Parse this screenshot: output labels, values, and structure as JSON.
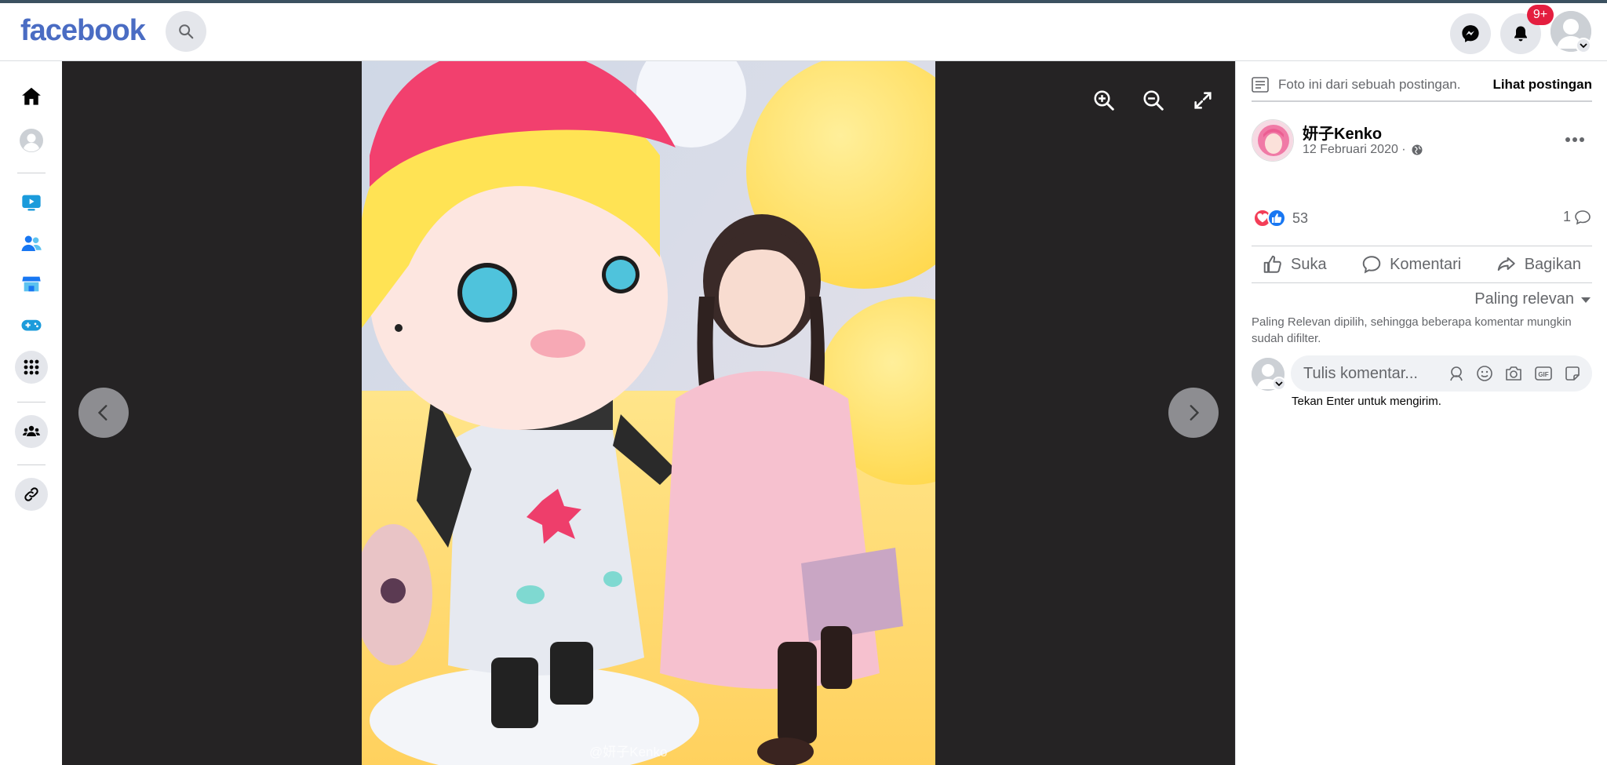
{
  "header": {
    "logo_text": "facebook",
    "notification_badge": "9+"
  },
  "viewer": {
    "watermark": "@妍子Kenko"
  },
  "post": {
    "info_text": "Foto ini dari sebuah postingan.",
    "view_post_link": "Lihat postingan",
    "author": "妍子Kenko",
    "date": "12 Februari 2020 ·",
    "reaction_count": "53",
    "comment_count": "1",
    "actions": {
      "like": "Suka",
      "comment": "Komentari",
      "share": "Bagikan"
    },
    "sort_label": "Paling relevan",
    "sort_note": "Paling Relevan dipilih, sehingga beberapa komentar mungkin sudah difilter.",
    "comment_placeholder": "Tulis komentar...",
    "enter_hint": "Tekan Enter untuk mengirim."
  },
  "colors": {
    "brand": "#4a6cc3",
    "viewer_bg": "#252324",
    "badge": "#e41e3f",
    "love": "#f33e58",
    "like": "#1877f2"
  }
}
